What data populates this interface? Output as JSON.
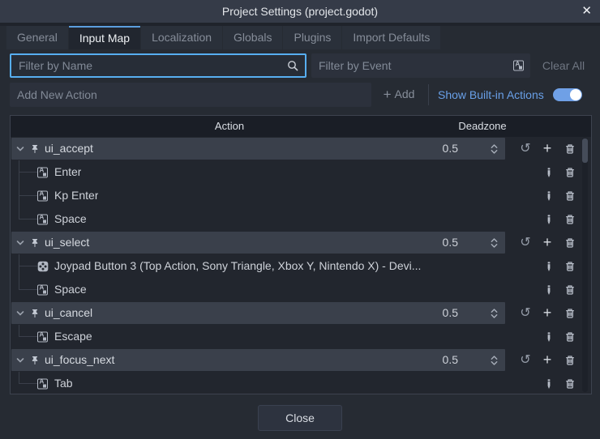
{
  "window": {
    "title": "Project Settings (project.godot)"
  },
  "tabs": [
    {
      "label": "General",
      "active": false
    },
    {
      "label": "Input Map",
      "active": true
    },
    {
      "label": "Localization",
      "active": false
    },
    {
      "label": "Globals",
      "active": false
    },
    {
      "label": "Plugins",
      "active": false
    },
    {
      "label": "Import Defaults",
      "active": false
    }
  ],
  "filters": {
    "name_placeholder": "Filter by Name",
    "event_placeholder": "Filter by Event",
    "clear_all_label": "Clear All"
  },
  "add_action": {
    "placeholder": "Add New Action",
    "add_label": "Add",
    "show_builtin_label": "Show Built-in Actions",
    "toggle_on": true
  },
  "table": {
    "columns": [
      "Action",
      "Deadzone"
    ],
    "actions": [
      {
        "name": "ui_accept",
        "deadzone": "0.5",
        "events": [
          {
            "label": "Enter",
            "type": "key"
          },
          {
            "label": "Kp Enter",
            "type": "key"
          },
          {
            "label": "Space",
            "type": "key"
          }
        ]
      },
      {
        "name": "ui_select",
        "deadzone": "0.5",
        "events": [
          {
            "label": "Joypad Button 3 (Top Action, Sony Triangle, Xbox Y, Nintendo X) - Devi...",
            "type": "joypad"
          },
          {
            "label": "Space",
            "type": "key"
          }
        ]
      },
      {
        "name": "ui_cancel",
        "deadzone": "0.5",
        "events": [
          {
            "label": "Escape",
            "type": "key"
          }
        ]
      },
      {
        "name": "ui_focus_next",
        "deadzone": "0.5",
        "events": [
          {
            "label": "Tab",
            "type": "key"
          }
        ]
      }
    ]
  },
  "footer": {
    "close_label": "Close"
  },
  "icons": {
    "close_glyph": "✕",
    "revert_glyph": "↺",
    "plus_glyph": "+",
    "add_plus_glyph": "+",
    "search_icon": "magnifying-glass",
    "keyboard_icon": "keycap-letter-A",
    "joypad_icon": "gamepad-four-buttons",
    "pin_icon": "pushpin",
    "chevron_icon": "chevron-down",
    "spinner_icon": "up-down-arrows",
    "edit_icon": "pencil",
    "delete_icon": "trash-can"
  },
  "colors": {
    "accent_blue": "#5b9ede",
    "toggle_on": "#6fa0e6",
    "focus_border": "#57aef0",
    "titlebar": "#353b48",
    "body": "#262b33",
    "row_band": "#3a404b"
  }
}
